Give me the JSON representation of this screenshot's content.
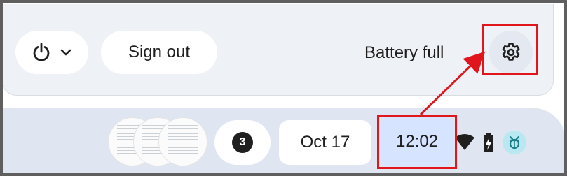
{
  "quick_settings": {
    "power_menu_icon": "power-icon",
    "power_chevron_icon": "chevron-down-icon",
    "sign_out_label": "Sign out",
    "battery_status": "Battery full",
    "settings_icon": "gear-icon"
  },
  "shelf": {
    "notification_count": "3",
    "date": "Oct 17",
    "time": "12:02",
    "status_icons": [
      "wifi-icon",
      "battery-charging-icon",
      "accessibility-icon"
    ]
  },
  "annotation": {
    "highlight_color": "#e0161c",
    "highlighted_elements": [
      "settings-button",
      "clock"
    ]
  },
  "colors": {
    "panel_background": "#eef1f6",
    "shelf_background": "#dfe6f2",
    "clock_highlight": "#d6e4ff",
    "accent_teal": "#1a7f8a"
  }
}
